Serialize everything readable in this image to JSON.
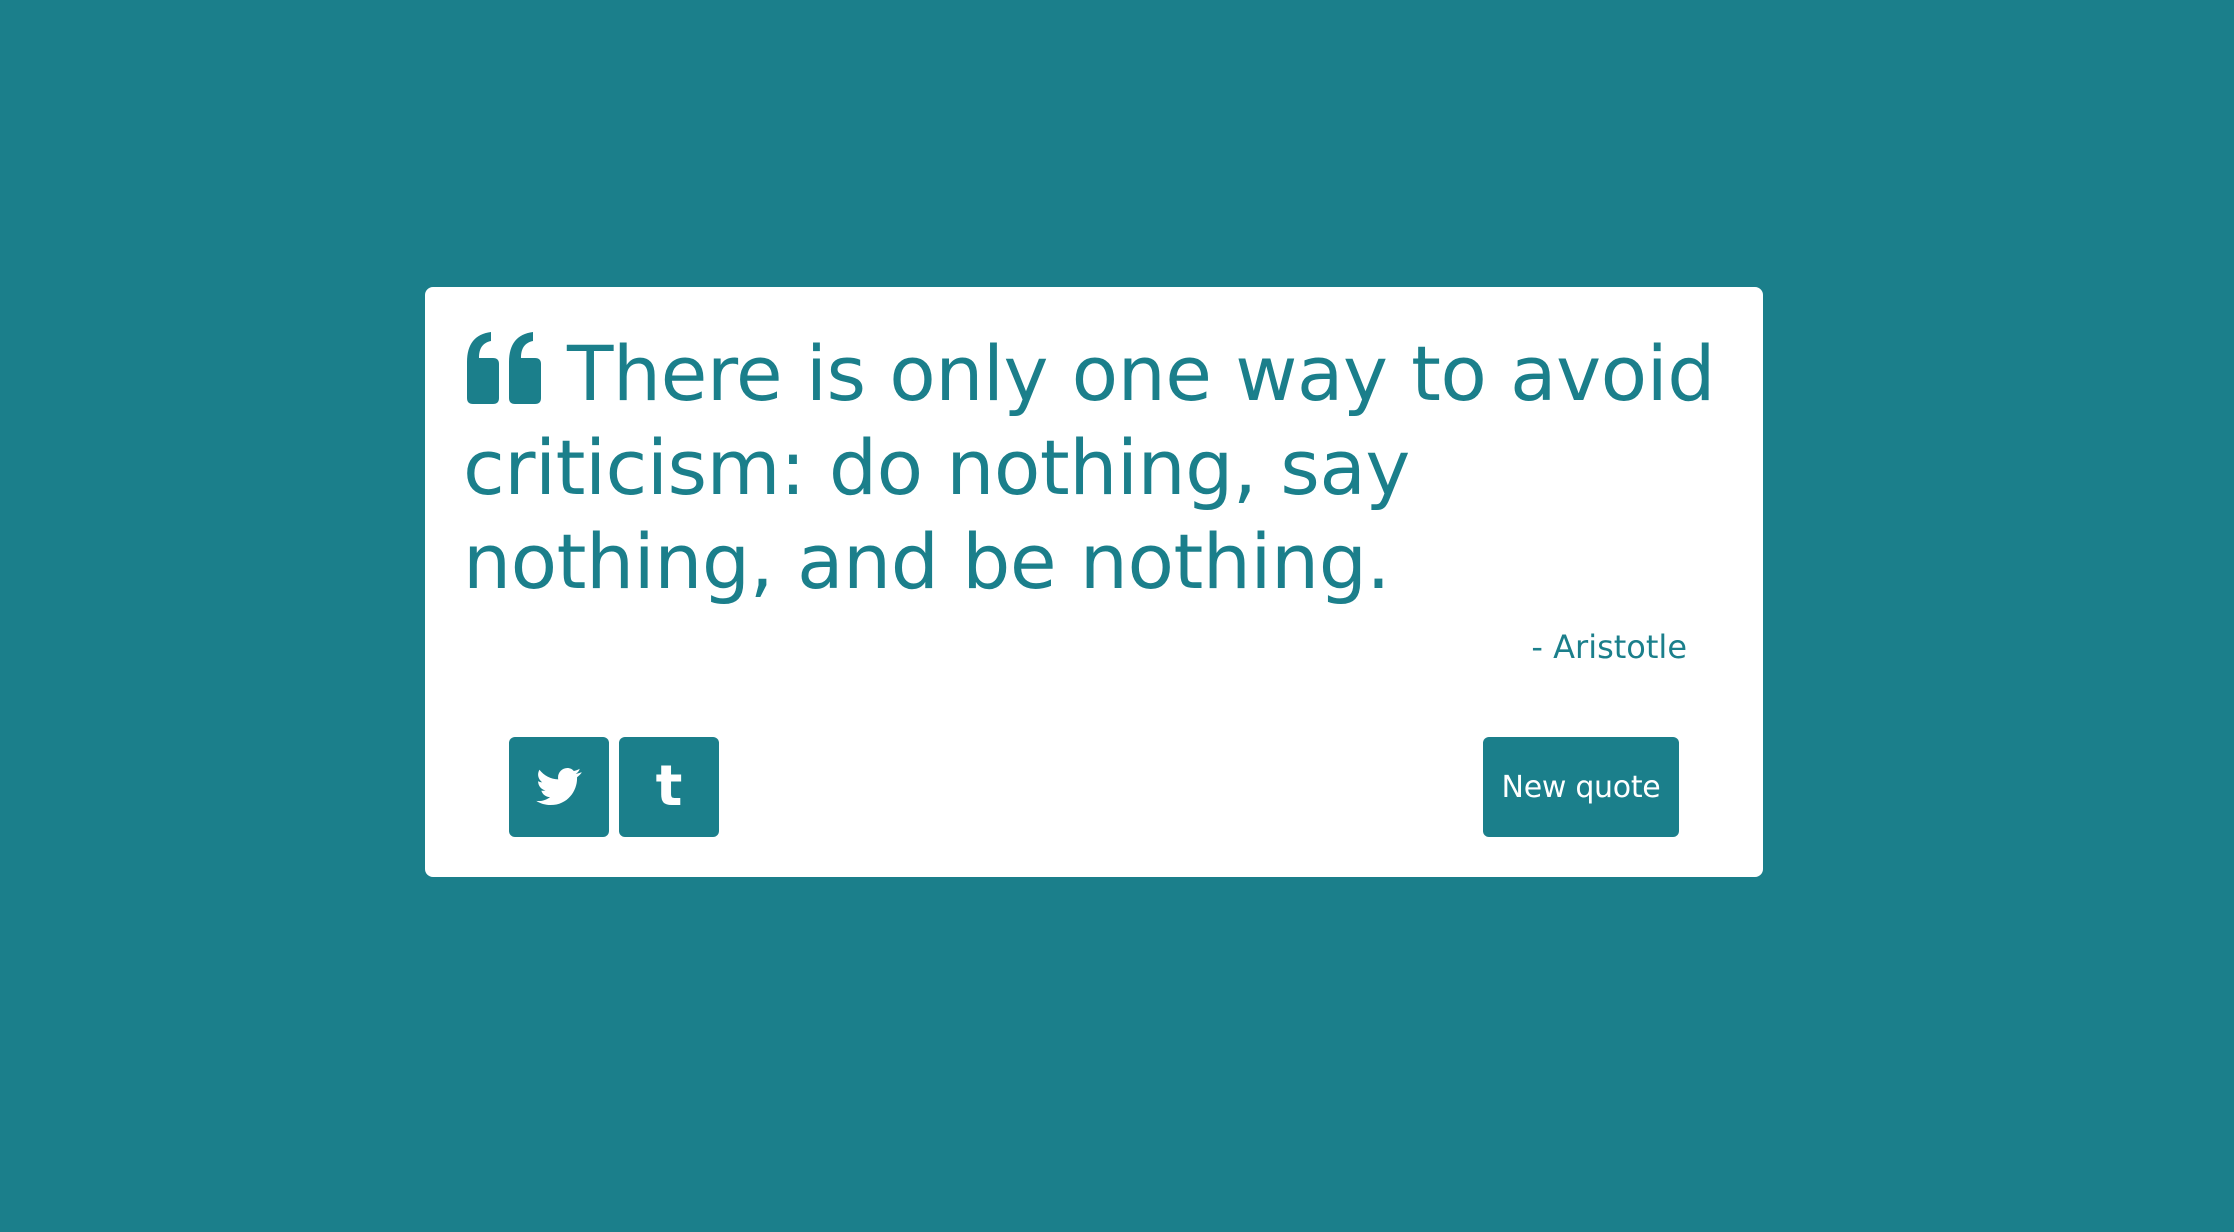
{
  "quote": {
    "text": "There is only one way to avoid criticism: do nothing, say nothing, and be nothing.",
    "author": "- Aristotle"
  },
  "actions": {
    "tweet_icon": "twitter-icon",
    "tumblr_icon": "tumblr-icon",
    "tumblr_glyph": "t",
    "new_quote_label": "New quote"
  },
  "colors": {
    "background": "#1b7f8b",
    "card": "#ffffff",
    "accent": "#1b7f8b"
  }
}
